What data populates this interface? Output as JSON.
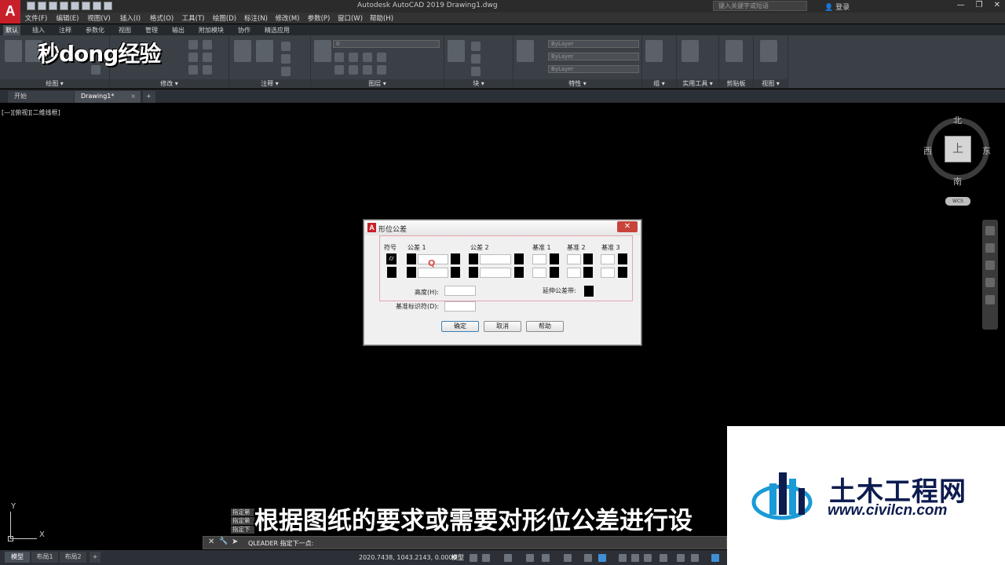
{
  "app": {
    "logo_letter": "A",
    "title": "Autodesk AutoCAD 2019    Drawing1.dwg",
    "search_placeholder": "键入关键字或短语",
    "login_label": "登录",
    "window_controls": [
      "—",
      "❐",
      "✕"
    ]
  },
  "menubar": {
    "items": [
      "文件(F)",
      "编辑(E)",
      "视图(V)",
      "插入(I)",
      "格式(O)",
      "工具(T)",
      "绘图(D)",
      "标注(N)",
      "修改(M)",
      "参数(P)",
      "窗口(W)",
      "帮助(H)"
    ]
  },
  "ribbon_tabs": {
    "items": [
      "默认",
      "插入",
      "注释",
      "参数化",
      "视图",
      "管理",
      "输出",
      "附加模块",
      "协作",
      "精选应用"
    ],
    "active": "默认"
  },
  "ribbon": {
    "panels": [
      "绘图 ▾",
      "修改 ▾",
      "注释 ▾",
      "图层 ▾",
      "块 ▾",
      "特性 ▾",
      "组 ▾",
      "实用工具 ▾",
      "剪贴板",
      "视图 ▾"
    ],
    "layer_value": "0",
    "bylayer_color": "ByLayer",
    "bylayer_linetype": "ByLayer",
    "bylayer_lineweight": "ByLayer"
  },
  "watermark_top": {
    "text": "秒dong经验"
  },
  "doc_tabs": {
    "start": "开始",
    "drawing": "Drawing1*",
    "close": "×",
    "add": "+"
  },
  "viewport_label": "[—][俯视][二维线框]",
  "viewcube": {
    "north": "北",
    "south": "南",
    "east": "东",
    "west": "西",
    "top": "上",
    "wcs": "WCS"
  },
  "dialog": {
    "title": "形位公差",
    "close": "✕",
    "headers": {
      "symbol": "符号",
      "tolerance1": "公差 1",
      "tolerance2": "公差 2",
      "datum1": "基准 1",
      "datum2": "基准 2",
      "datum3": "基准 3"
    },
    "height_label": "高度(H):",
    "projected_zone_label": "延伸公差带:",
    "datum_identifier_label": "基准标识符(D):",
    "cursor_mark": "Q",
    "buttons": {
      "ok": "确定",
      "cancel": "取消",
      "help": "帮助"
    }
  },
  "ucs": {
    "x": "X",
    "y": "Y"
  },
  "command_history": [
    "指定第",
    "指定第",
    "指定下"
  ],
  "subtitle": "根据图纸的要求或需要对形位公差进行设",
  "command_line": {
    "x_icon": "✕",
    "wrench_icon": "🔧",
    "arrow": "➤",
    "text": "QLEADER 指定下一点:"
  },
  "layout_tabs": [
    "模型",
    "布局1",
    "布局2",
    "+"
  ],
  "status_bar": {
    "coordinates": "2020.7438, 1043.2143, 0.0000",
    "model": "模型"
  },
  "watermark_bottom": {
    "title": "土木工程网",
    "url": "www.civilcn.com"
  },
  "colors": {
    "autocad_red": "#c8202a",
    "ribbon_bg": "#3b4047",
    "status_accent": "#3f8fd6",
    "watermark_blue": "#0d1c4f",
    "watermark_light_blue": "#1a9ad6"
  }
}
